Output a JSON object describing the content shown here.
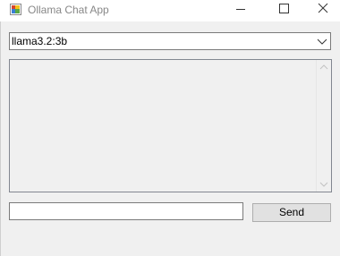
{
  "window": {
    "title": "Ollama Chat App"
  },
  "model_select": {
    "selected": "llama3.2:3b",
    "arrow_icon": "chevron-down-icon"
  },
  "chat_log": {
    "text": ""
  },
  "message_input": {
    "value": ""
  },
  "send_button": {
    "label": "Send"
  },
  "colors": {
    "window_bg": "#f0f0f0",
    "titlebar_bg": "#ffffff",
    "title_text": "#888888",
    "button_bg": "#e1e1e1",
    "border": "#7a7a7a"
  }
}
